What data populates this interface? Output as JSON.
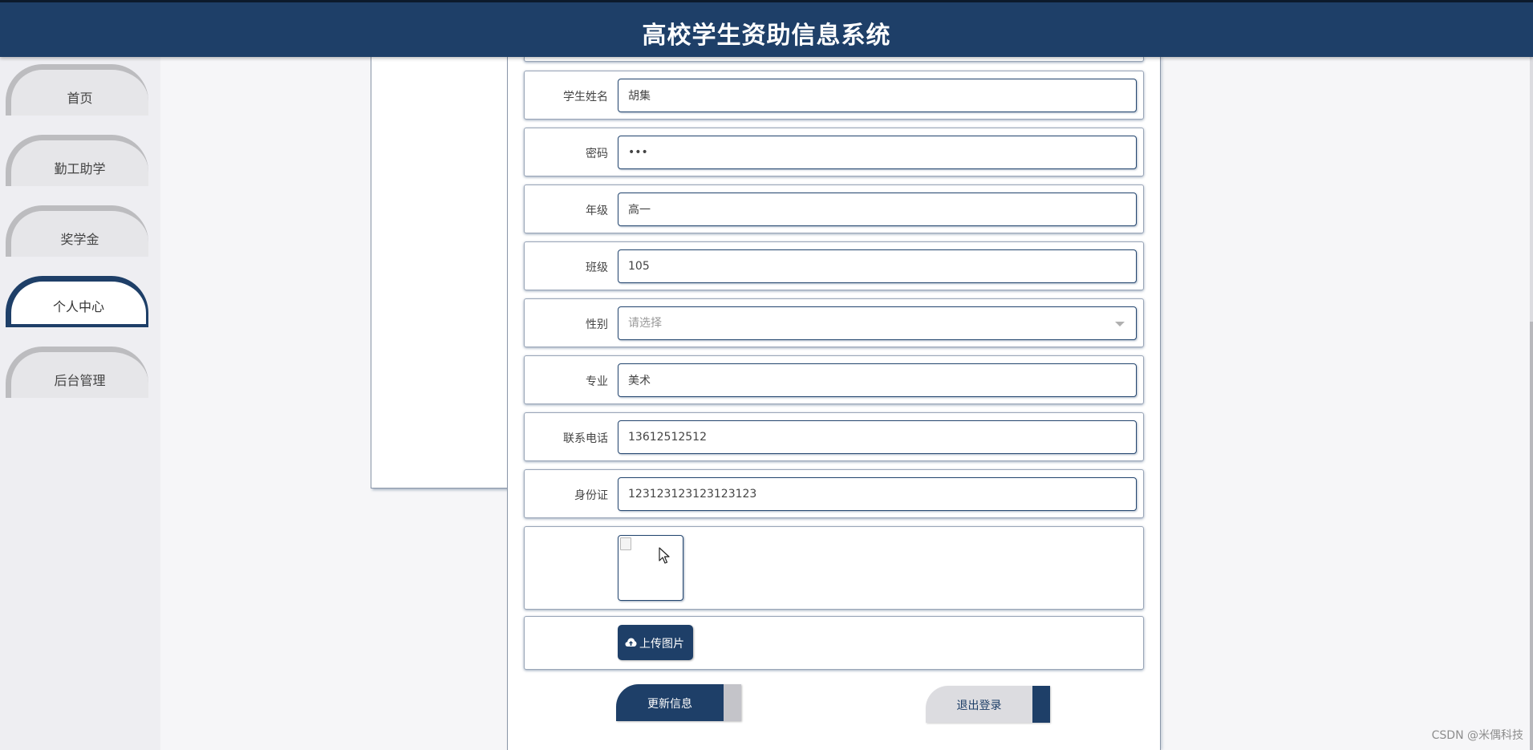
{
  "header": {
    "title": "高校学生资助信息系统"
  },
  "sidebar": {
    "items": [
      {
        "label": "首页",
        "active": false
      },
      {
        "label": "勤工助学",
        "active": false
      },
      {
        "label": "奖学金",
        "active": false
      },
      {
        "label": "个人中心",
        "active": true
      },
      {
        "label": "后台管理",
        "active": false
      }
    ]
  },
  "form": {
    "fields": [
      {
        "label": "学生姓名",
        "value": "胡集",
        "type": "text"
      },
      {
        "label": "密码",
        "value": "•••",
        "type": "password"
      },
      {
        "label": "年级",
        "value": "高一",
        "type": "text"
      },
      {
        "label": "班级",
        "value": "105",
        "type": "text"
      },
      {
        "label": "性别",
        "placeholder": "请选择",
        "type": "select"
      },
      {
        "label": "专业",
        "value": "美术",
        "type": "text"
      },
      {
        "label": "联系电话",
        "value": "13612512512",
        "type": "text"
      },
      {
        "label": "身份证",
        "value": "123123123123123123",
        "type": "text"
      }
    ],
    "upload_label": "上传图片",
    "update_label": "更新信息",
    "logout_label": "退出登录"
  },
  "icons": {
    "upload": "cloud-upload-icon",
    "broken_image": "broken-image-icon",
    "cursor": "mouse-pointer-icon",
    "dropdown": "chevron-down-icon"
  },
  "colors": {
    "primary": "#1e3f68",
    "tab_inactive": "#e6e6e9",
    "tab_shadow": "#bcbcbf",
    "page_bg": "#f6f6f8"
  },
  "watermark": "CSDN @米偶科技"
}
